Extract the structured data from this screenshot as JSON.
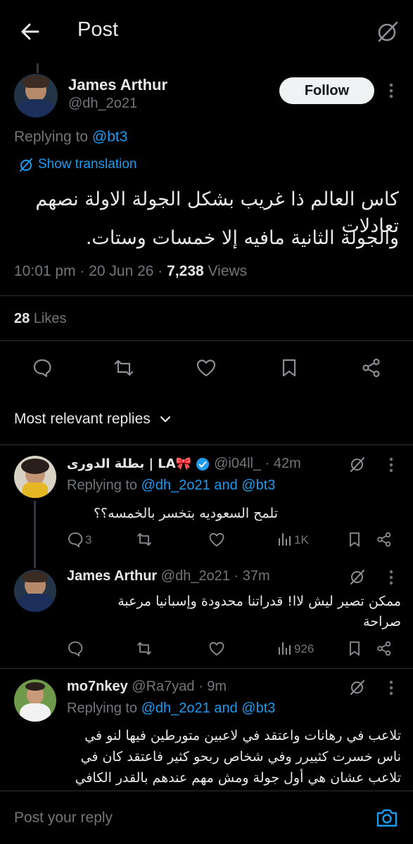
{
  "header": {
    "title": "Post",
    "back_icon": "arrow-left-icon",
    "grok_icon": "grok-icon"
  },
  "main_post": {
    "author_name": "James Arthur",
    "handle": "@dh_2o21",
    "follow_label": "Follow",
    "replying_prefix": "Replying to",
    "replying_handle": "@bt3",
    "show_translation": "Show translation",
    "text_line1": "كاس العالم ذا غريب بشكل الجولة الاولة نصهم تعادلات",
    "text_line2": "والجولة الثانية مافيه إلا خمسات وستات.",
    "time": "10:01 pm · 20 Jun 26 ·",
    "views_count": "7,238",
    "views_label": "Views",
    "likes_count": "28",
    "likes_label": "Likes"
  },
  "sort_label": "Most relevant replies",
  "replies": [
    {
      "name": "بطلة الدورى | LA🎀",
      "name_display": "بطلة الدورى | LA🎀",
      "handle_time": "@i04ll_ · 42m",
      "replying": "Replying to",
      "replying_to": "@dh_2o21 and @bt3",
      "text_line1": "تلمح السعوديه بتخسر بالخمسه؟؟",
      "reply_count": "3",
      "views": "1K"
    },
    {
      "name": "James Arthur",
      "handle_time": "@dh_2o21 · 37m",
      "text_line1": "ممكن تصير ليش لاا! قدراتنا محدودة وإسبانيا مرعبة",
      "text_line2": "صراحة",
      "views": "926"
    },
    {
      "name": "mo7nkey",
      "handle_time": "@Ra7yad · 9m",
      "replying": "Replying to",
      "replying_to": "@dh_2o21 and @bt3",
      "text_line1": "تلاعب في رهانات واعتقد في لاعبين متورطين فيها لنو في",
      "text_line2": "ناس خسرت كثييرر وفي شخاص ربحو كثير فاعتقد كان في",
      "text_line3": "تلاعب عشان هي أول جولة ومش مهم عندهم بالقدر الكافي"
    }
  ],
  "composer": {
    "placeholder": "Post your reply",
    "camera_icon": "camera-icon"
  },
  "colors": {
    "accent": "#1d9bf0",
    "background": "#000000",
    "muted": "#71767b",
    "verified": "#1d9bf0"
  }
}
